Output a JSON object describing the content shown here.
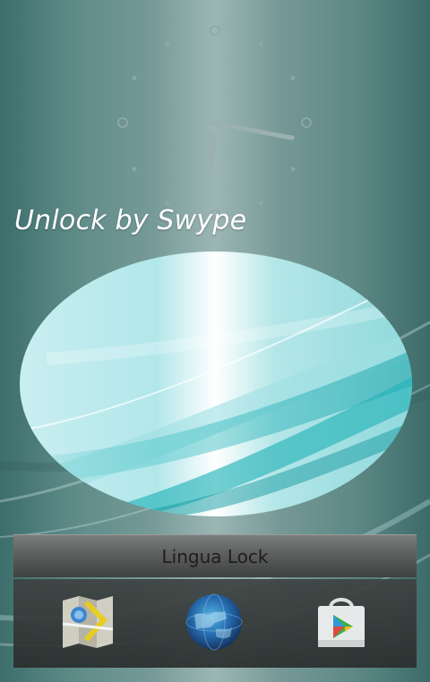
{
  "lock_screen": {
    "unlock_prompt": "Unlock by Swype"
  },
  "app": {
    "title": "Lingua Lock"
  },
  "dock": {
    "items": [
      {
        "icon": "maps-icon"
      },
      {
        "icon": "browser-globe-icon"
      },
      {
        "icon": "play-store-icon"
      }
    ]
  },
  "colors": {
    "wallpaper": "#6f9592",
    "oval_accent": "#2ec2c6",
    "title_bar": "#5d5f5e",
    "dock": "#2f3332"
  }
}
